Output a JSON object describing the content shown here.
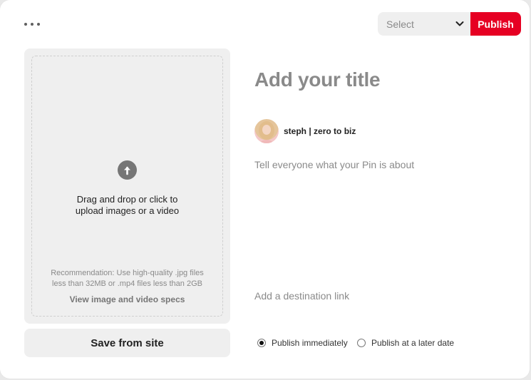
{
  "header": {
    "more_icon": "more-horizontal-icon",
    "select": {
      "placeholder": "Select",
      "icon": "chevron-down-icon"
    },
    "publish_label": "Publish",
    "publish_color": "#e60023"
  },
  "upload": {
    "icon": "arrow-up-circle-icon",
    "line1": "Drag and drop or click to",
    "line2": "upload images or a video",
    "recommend_line1": "Recommendation: Use high-quality .jpg files",
    "recommend_line2": "less than 32MB or .mp4 files less than 2GB",
    "specs_link": "View image and video specs"
  },
  "save_from_site_label": "Save from site",
  "pin": {
    "title_placeholder": "Add your title",
    "username": "steph | zero to biz",
    "description_placeholder": "Tell everyone what your Pin is about",
    "destination_placeholder": "Add a destination link"
  },
  "publish_options": [
    {
      "label": "Publish immediately",
      "checked": true
    },
    {
      "label": "Publish at a later date",
      "checked": false
    }
  ]
}
